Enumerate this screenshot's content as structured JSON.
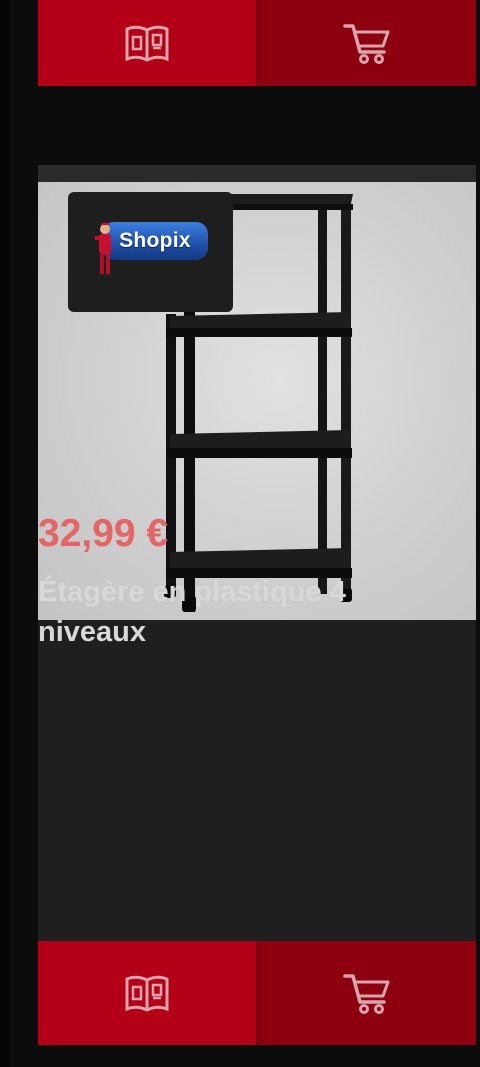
{
  "product": {
    "price": "32,99 €",
    "title": "Étagère en plastique 4 niveaux",
    "shop_logo_text": "Shopix"
  },
  "actions": {
    "catalog_icon": "open-book-icon",
    "cart_icon": "shopping-cart-icon"
  },
  "colors": {
    "catalog_button": "#b30017",
    "cart_button": "#8c0010",
    "price": "#e36565",
    "card_background": "#1f1f1f",
    "page_background": "#0c0c0c"
  }
}
